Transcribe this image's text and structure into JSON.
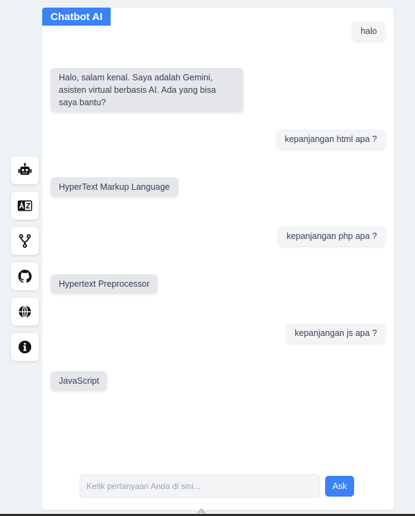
{
  "app": {
    "title": "Chatbot AI"
  },
  "sidebar": {
    "items": [
      {
        "icon": "robot-icon"
      },
      {
        "icon": "translate-icon"
      },
      {
        "icon": "fork-icon"
      },
      {
        "icon": "github-icon"
      },
      {
        "icon": "globe-icon"
      },
      {
        "icon": "info-icon"
      }
    ]
  },
  "chat": {
    "messages": [
      {
        "role": "user",
        "text": "halo"
      },
      {
        "role": "bot",
        "text": "Halo, salam kenal. Saya adalah Gemini, asisten virtual berbasis AI. Ada yang bisa saya bantu?"
      },
      {
        "role": "user",
        "text": "kepanjangan html apa ?"
      },
      {
        "role": "bot",
        "text": "HyperText Markup Language"
      },
      {
        "role": "user",
        "text": "kepanjangan php apa ?"
      },
      {
        "role": "bot",
        "text": "Hypertext Preprocessor"
      },
      {
        "role": "user",
        "text": "kepanjangan js apa ?"
      },
      {
        "role": "bot",
        "text": "JavaScript"
      }
    ]
  },
  "composer": {
    "placeholder": "Ketik pertanyaan Anda di sini...",
    "value": "",
    "button_label": "Ask"
  },
  "colors": {
    "accent": "#3b82f6",
    "background": "#eef2f5",
    "user_bubble": "#f3f4f6",
    "bot_bubble": "#e5e7eb"
  }
}
